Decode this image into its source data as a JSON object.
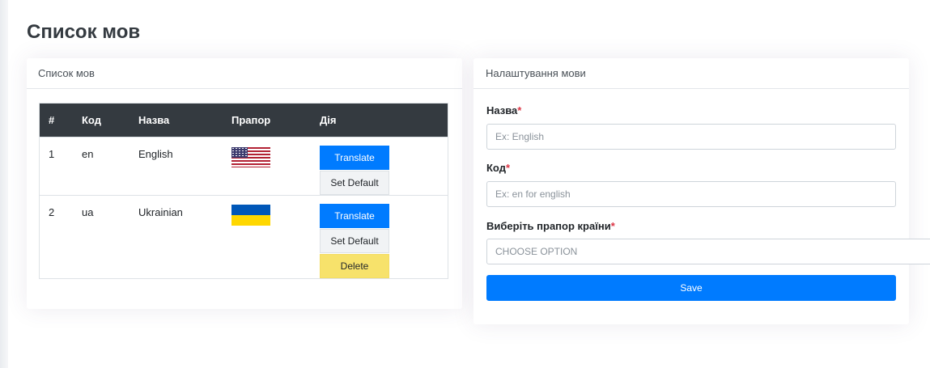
{
  "page": {
    "title": "Список мов"
  },
  "list_card": {
    "title": "Список мов",
    "columns": [
      "#",
      "Код",
      "Назва",
      "Прапор",
      "Дія"
    ],
    "rows": [
      {
        "num": "1",
        "code": "en",
        "name": "English",
        "flag": "us-flag-icon",
        "actions": {
          "translate": "Translate",
          "set_default": "Set Default"
        }
      },
      {
        "num": "2",
        "code": "ua",
        "name": "Ukrainian",
        "flag": "ukraine-flag-icon",
        "actions": {
          "translate": "Translate",
          "set_default": "Set Default",
          "delete": "Delete"
        }
      }
    ]
  },
  "settings_card": {
    "title": "Налаштування мови",
    "name_field": {
      "label": "Назва",
      "required_mark": "*",
      "placeholder": "Ex: English",
      "value": ""
    },
    "code_field": {
      "label": "Код",
      "required_mark": "*",
      "placeholder": "Ex: en for english",
      "value": ""
    },
    "flag_field": {
      "label": "Виберіть прапор країни",
      "required_mark": "*",
      "selected": "CHOOSE OPTION"
    },
    "save_label": "Save"
  },
  "colors": {
    "primary": "#007bff",
    "table_header": "#343a40",
    "warning": "#f7e26b",
    "required": "#dc3545"
  }
}
